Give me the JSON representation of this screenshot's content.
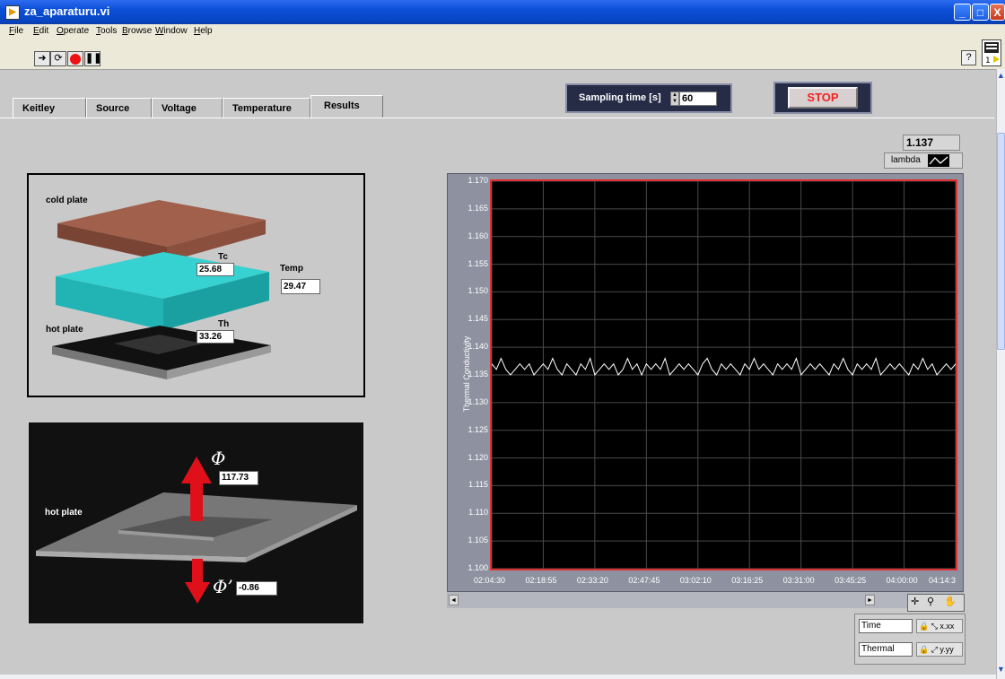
{
  "window": {
    "title": "za_aparaturu.vi"
  },
  "menu": [
    {
      "u": "F",
      "rest": "ile"
    },
    {
      "u": "E",
      "rest": "dit"
    },
    {
      "u": "O",
      "rest": "perate"
    },
    {
      "u": "T",
      "rest": "ools"
    },
    {
      "u": "B",
      "rest": "rowse"
    },
    {
      "u": "W",
      "rest": "indow"
    },
    {
      "u": "H",
      "rest": "elp"
    }
  ],
  "toolbar": {
    "run_icon": "run-arrow-icon",
    "continuous_icon": "run-continuously-icon",
    "abort_icon": "abort-icon",
    "pause_icon": "pause-icon",
    "help_label": "?"
  },
  "tabs": [
    "Keitley",
    "Source",
    "Voltage",
    "Temperature",
    "Results"
  ],
  "active_tab": "Results",
  "sampling": {
    "label": "Sampling time  [s]",
    "value": "60"
  },
  "stop_label": "STOP",
  "diagram_top": {
    "cold_plate_label": "cold plate",
    "hot_plate_label": "hot plate",
    "tc_label": "Tc",
    "tc_value": "25.68",
    "th_label": "Th",
    "th_value": "33.26",
    "temp_label": "Temp",
    "temp_value": "29.47"
  },
  "diagram_bottom": {
    "hot_plate_label": "hot plate",
    "phi_label": "Φ",
    "phi_value": "117.73",
    "phi_prime_label": "Φ’",
    "phi_prime_value": "-0.86"
  },
  "lambda": {
    "value": "1.137",
    "legend": "lambda"
  },
  "graph_palette": {
    "time_label": "Time",
    "thermal_label": "Thermal"
  },
  "chart_data": {
    "type": "line",
    "ylabel": "Thermal Conductivity",
    "ylim": [
      1.1,
      1.17
    ],
    "yticks": [
      "1.170",
      "1.165",
      "1.160",
      "1.155",
      "1.150",
      "1.145",
      "1.140",
      "1.135",
      "1.130",
      "1.125",
      "1.120",
      "1.115",
      "1.110",
      "1.105",
      "1.100"
    ],
    "xticks": [
      "02:04:30",
      "02:18:55",
      "02:33:20",
      "02:47:45",
      "03:02:10",
      "03:16:25",
      "03:31:00",
      "03:45:25",
      "04:00:00",
      "04:14:3"
    ],
    "series": [
      {
        "values": [
          1.137,
          1.136,
          1.138,
          1.136,
          1.135,
          1.136,
          1.137,
          1.136,
          1.137,
          1.135,
          1.136,
          1.137,
          1.136,
          1.138,
          1.136,
          1.135,
          1.137,
          1.136,
          1.135,
          1.137,
          1.136,
          1.138,
          1.135,
          1.136,
          1.137,
          1.136,
          1.137,
          1.135,
          1.136,
          1.138,
          1.136,
          1.137,
          1.135,
          1.137,
          1.136,
          1.137,
          1.136,
          1.138,
          1.135,
          1.136,
          1.137,
          1.136,
          1.137,
          1.136,
          1.135,
          1.137,
          1.138,
          1.136,
          1.135,
          1.137,
          1.136,
          1.137,
          1.136,
          1.135,
          1.137,
          1.136,
          1.138,
          1.136,
          1.137,
          1.136,
          1.135,
          1.137,
          1.136,
          1.137,
          1.136,
          1.138,
          1.135,
          1.136,
          1.137,
          1.136,
          1.137,
          1.136,
          1.135,
          1.137,
          1.136,
          1.138,
          1.136,
          1.135,
          1.137,
          1.136,
          1.137,
          1.136,
          1.138,
          1.135,
          1.136,
          1.137,
          1.136,
          1.137,
          1.136,
          1.135,
          1.137,
          1.136,
          1.138,
          1.136,
          1.137,
          1.135,
          1.136,
          1.137,
          1.136,
          1.137
        ]
      }
    ]
  }
}
